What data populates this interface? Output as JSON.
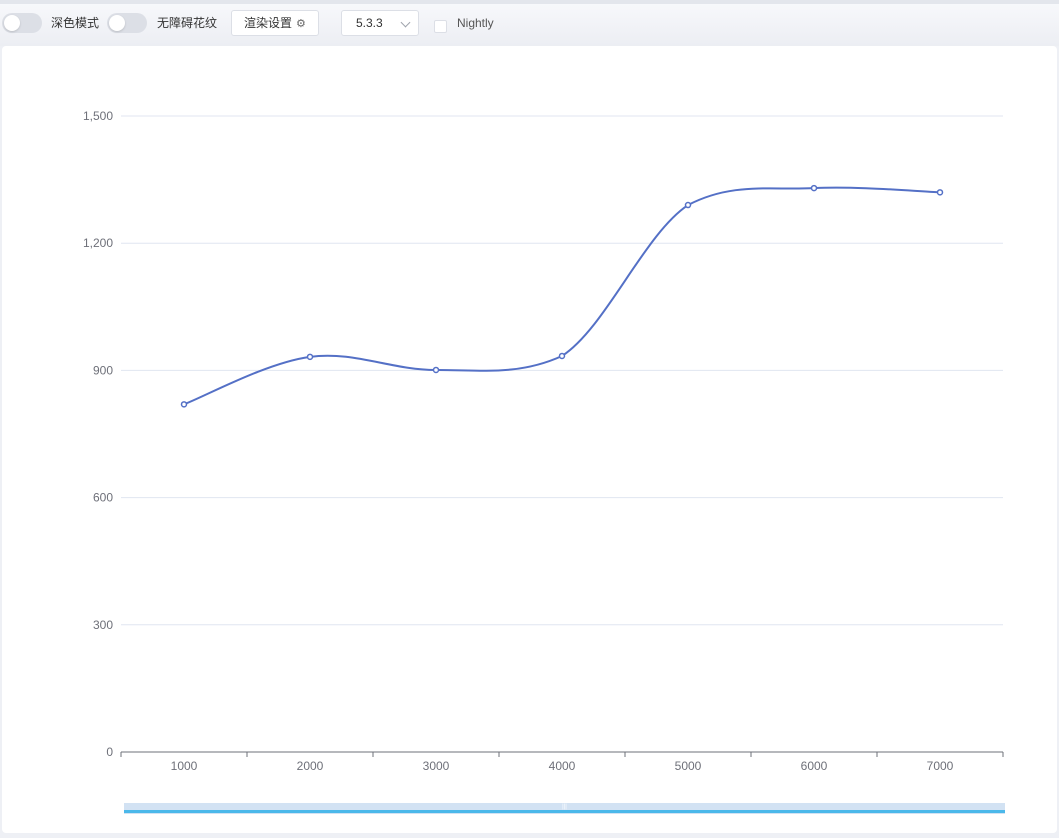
{
  "toolbar": {
    "dark_mode_label": "深色模式",
    "accessibility_label": "无障碍花纹",
    "render_settings_label": "渲染设置",
    "render_settings_icon": "gear-icon",
    "version_value": "5.3.3",
    "nightly_label": "Nightly"
  },
  "colors": {
    "series": "#5470c6",
    "axis": "#6e7079",
    "grid": "#e0e6f1",
    "slider": "#4bb8ea"
  },
  "chart_data": {
    "type": "line",
    "smooth": true,
    "x": [
      1000,
      2000,
      3000,
      4000,
      5000,
      6000,
      7000
    ],
    "x_tick_labels": [
      "1000",
      "2000",
      "3000",
      "4000",
      "5000",
      "6000",
      "7000"
    ],
    "series": [
      {
        "values": [
          820,
          932,
          901,
          934,
          1290,
          1330,
          1320
        ]
      }
    ],
    "y_ticks": [
      0,
      300,
      600,
      900,
      1200,
      1500
    ],
    "y_tick_labels": [
      "0",
      "300",
      "600",
      "900",
      "1,200",
      "1,500"
    ],
    "ylim": [
      0,
      1500
    ],
    "grid": true,
    "data_zoom": {
      "type": "slider",
      "start_percent": 0,
      "end_percent": 100
    }
  }
}
